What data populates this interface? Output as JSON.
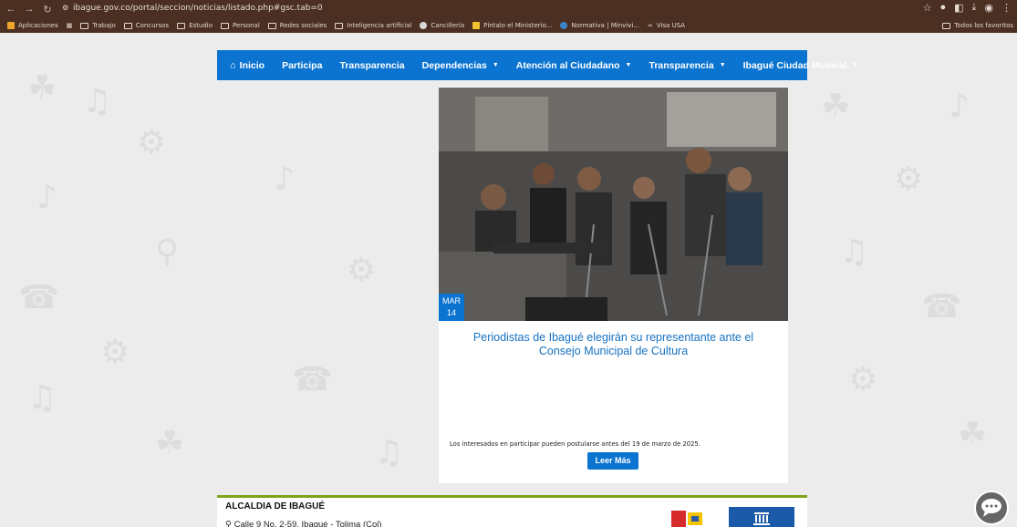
{
  "browser": {
    "url": "ibague.gov.co/portal/seccion/noticias/listado.php#gsc.tab=0",
    "bookmarks": [
      {
        "label": "Aplicaciones",
        "icon": "grid-icon"
      },
      {
        "label": "Trabajo",
        "icon": "folder-icon"
      },
      {
        "label": "Concursos",
        "icon": "folder-icon"
      },
      {
        "label": "Estudio",
        "icon": "folder-icon"
      },
      {
        "label": "Personal",
        "icon": "folder-icon"
      },
      {
        "label": "Redes sociales",
        "icon": "folder-icon"
      },
      {
        "label": "Inteligencia artificial",
        "icon": "folder-icon"
      },
      {
        "label": "Cancillería",
        "icon": "globe-icon"
      },
      {
        "label": "Píntalo el Ministerio...",
        "icon": "site-icon"
      },
      {
        "label": "Normativa | Minvivi...",
        "icon": "shield-icon"
      },
      {
        "label": "Visa USA",
        "icon": "link-icon"
      }
    ],
    "all_bookmarks_label": "Todos los favoritos"
  },
  "nav": {
    "items": [
      {
        "label": "Inicio",
        "has_caret": false
      },
      {
        "label": "Participa",
        "has_caret": false
      },
      {
        "label": "Transparencia",
        "has_caret": false
      },
      {
        "label": "Dependencias",
        "has_caret": true
      },
      {
        "label": "Atención al Ciudadano",
        "has_caret": true
      },
      {
        "label": "Transparencia",
        "has_caret": true
      },
      {
        "label": "Ibagué Ciudad Musical",
        "has_caret": true
      }
    ],
    "color": "#0a74d0"
  },
  "news": {
    "date_month": "MAR",
    "date_day": "14",
    "title": "Periodistas de Ibagué elegirán su representante ante el Consejo Municipal de Cultura",
    "summary": "Los interesados en participar pueden postularse antes del 19 de marzo de 2025.",
    "button_label": "Leer Más"
  },
  "footer": {
    "title": "ALCALDIA DE IBAGUÉ",
    "address": "Calle 9 No. 2-59, Ibagué - Tolima (Col)"
  }
}
